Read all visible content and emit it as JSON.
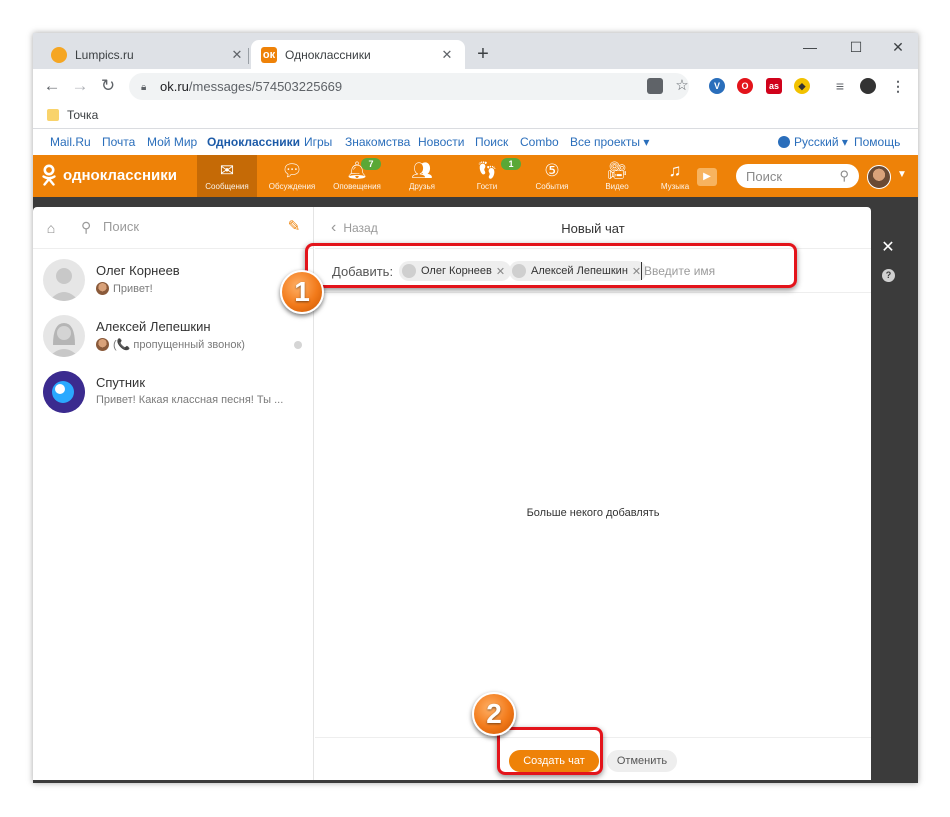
{
  "browser": {
    "tabs": [
      {
        "title": "Lumpics.ru",
        "active": false
      },
      {
        "title": "Одноклассники",
        "active": true
      }
    ],
    "new_tab": "+",
    "window_controls": {
      "minimize": "—",
      "maximize": "☐",
      "close": "✕"
    },
    "address": {
      "host": "ok.ru",
      "path": "/messages/574503225669"
    },
    "bookmarks": [
      {
        "label": "Точка"
      }
    ]
  },
  "site_nav": {
    "links": [
      "Mail.Ru",
      "Почта",
      "Мой Мир",
      "Одноклассники",
      "Игры",
      "Знакомства",
      "Новости",
      "Поиск",
      "Combo",
      "Все проекты ▾"
    ],
    "language": "Русский ▾",
    "help": "Помощь"
  },
  "ok_bar": {
    "logo_text": "одноклассники",
    "items": [
      {
        "label": "Сообщения",
        "icon": "envelope-icon",
        "badge": ""
      },
      {
        "label": "Обсуждения",
        "icon": "chat-bubbles-icon",
        "badge": ""
      },
      {
        "label": "Оповещения",
        "icon": "bell-icon",
        "badge": "7"
      },
      {
        "label": "Друзья",
        "icon": "friends-icon",
        "badge": ""
      },
      {
        "label": "Гости",
        "icon": "footprints-icon",
        "badge": "1"
      },
      {
        "label": "События",
        "icon": "events-icon",
        "badge": ""
      },
      {
        "label": "Видео",
        "icon": "video-camera-icon",
        "badge": ""
      },
      {
        "label": "Музыка",
        "icon": "music-note-icon",
        "badge": ""
      }
    ],
    "search_placeholder": "Поиск"
  },
  "sidebar": {
    "search_placeholder": "Поиск",
    "conversations": [
      {
        "name": "Олег Корнеев",
        "preview": "Привет!"
      },
      {
        "name": "Алексей Лепешкин",
        "preview": "(📞 пропущенный звонок)"
      },
      {
        "name": "Спутник",
        "preview": "Привет! Какая классная песня! Ты ..."
      }
    ]
  },
  "chat": {
    "back_label": "Назад",
    "title": "Новый чат",
    "add_label": "Добавить:",
    "recipients": [
      {
        "name": "Олег Корнеев"
      },
      {
        "name": "Алексей Лепешкин"
      }
    ],
    "name_placeholder": "Введите имя",
    "empty_message": "Больше некого добавлять",
    "create_button": "Создать чат",
    "cancel_button": "Отменить"
  },
  "callouts": [
    {
      "number": "1"
    },
    {
      "number": "2"
    }
  ],
  "colors": {
    "brand_orange": "#ee8208",
    "highlight_red": "#e3141b",
    "badge_green": "#5aa836",
    "link_blue": "#2a6ebb"
  }
}
